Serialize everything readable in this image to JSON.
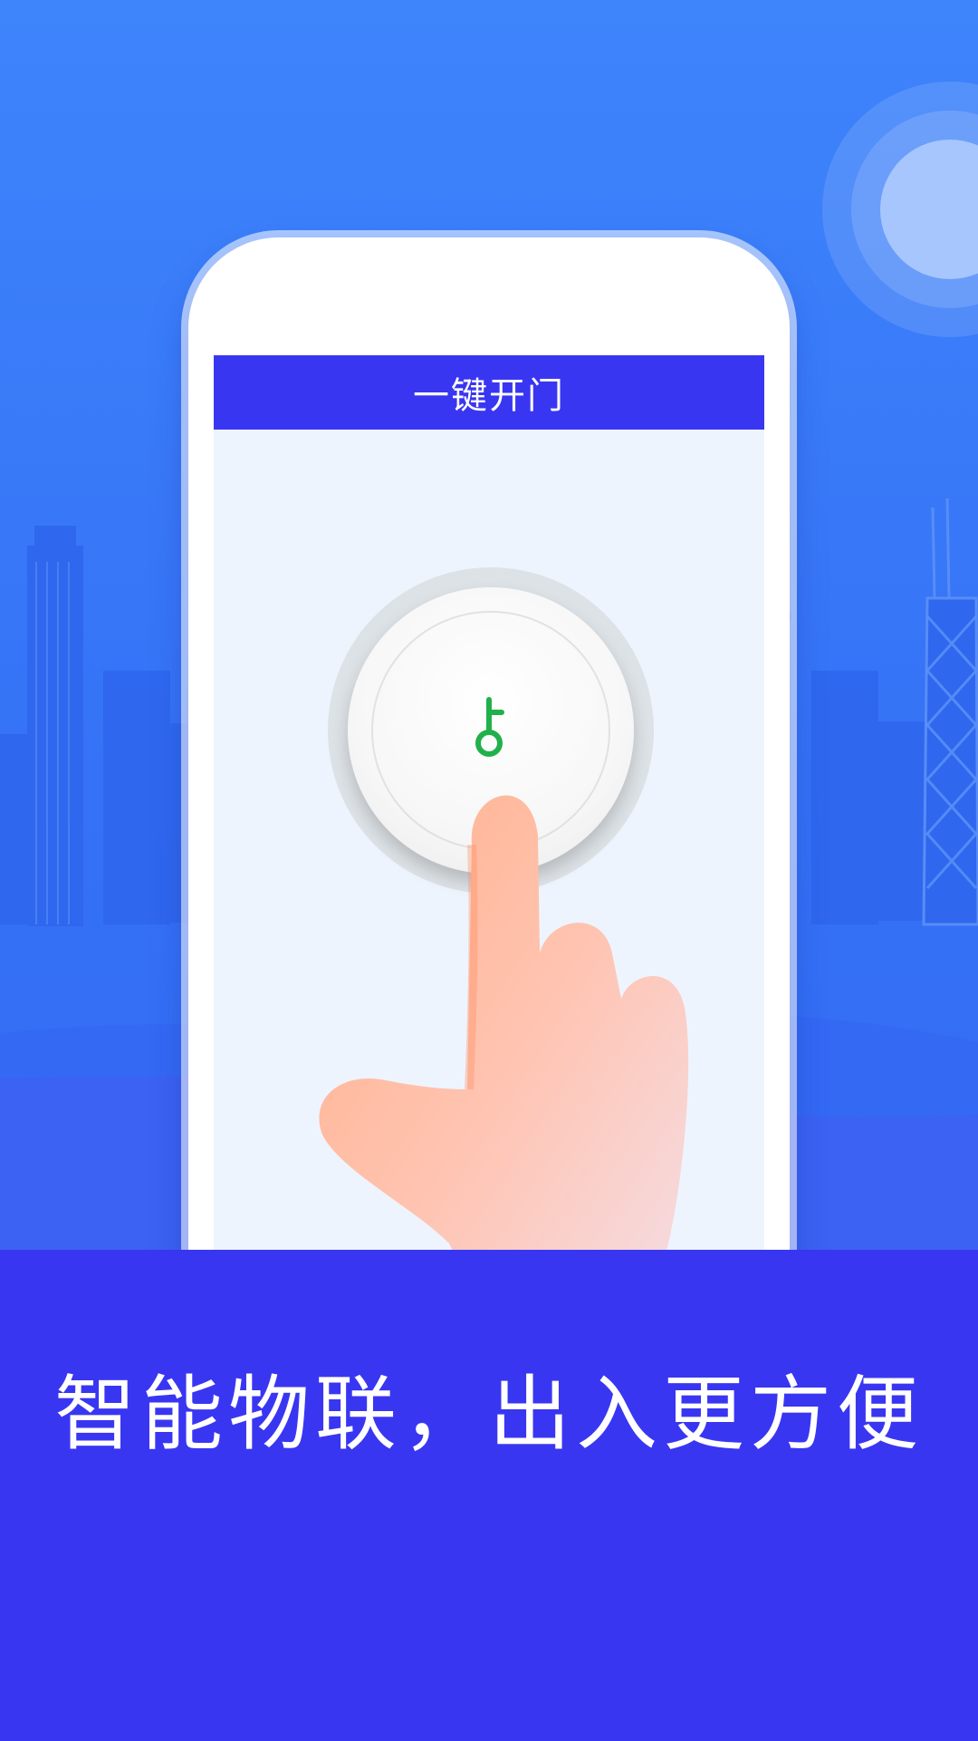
{
  "colors": {
    "background": "#3e84fb",
    "accent": "#3936f2",
    "screen": "#eef4fd",
    "key_icon": "#22b04b"
  },
  "phone": {
    "title": "一键开门",
    "button_icon": "key-icon"
  },
  "banner": {
    "slogan": "智能物联，出入更方便"
  }
}
